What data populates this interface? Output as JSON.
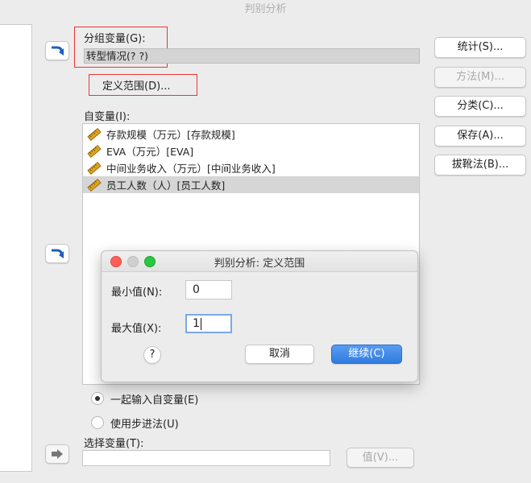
{
  "window": {
    "title": "判别分析"
  },
  "grouping": {
    "label": "分组变量(G):",
    "value": "转型情况(? ?)",
    "define_range_label": "定义范围(D)..."
  },
  "independent": {
    "label": "自变量(I):",
    "items": [
      {
        "label": "存款规模（万元）[存款规模]",
        "selected": false
      },
      {
        "label": "EVA（万元）[EVA]",
        "selected": false
      },
      {
        "label": "中间业务收入（万元）[中间业务收入]",
        "selected": false
      },
      {
        "label": "员工人数（人）[员工人数]",
        "selected": true
      }
    ]
  },
  "side_buttons": {
    "statistics": "统计(S)...",
    "method": "方法(M)...",
    "classify": "分类(C)...",
    "save": "保存(A)...",
    "bootstrap": "拔靴法(B)..."
  },
  "method_radios": {
    "enter_together": {
      "label": "一起输入自变量(E)",
      "checked": true
    },
    "stepwise": {
      "label": "使用步进法(U)",
      "checked": false
    }
  },
  "selection": {
    "label": "选择变量(T):",
    "value": "",
    "value_button": "值(V)..."
  },
  "dialog": {
    "title": "判别分析: 定义范围",
    "min_label": "最小值(N):",
    "min_value": "0",
    "max_label": "最大值(X):",
    "max_value": "1",
    "help_label": "?",
    "cancel_label": "取消",
    "continue_label": "继续(C)"
  },
  "colors": {
    "accent": "#2f7de1",
    "highlight_border": "#e53935",
    "traffic_red": "#ff5f57",
    "traffic_green": "#28c840",
    "traffic_gray": "#d0d0d0",
    "ruler_icon": "#e0a21b"
  }
}
